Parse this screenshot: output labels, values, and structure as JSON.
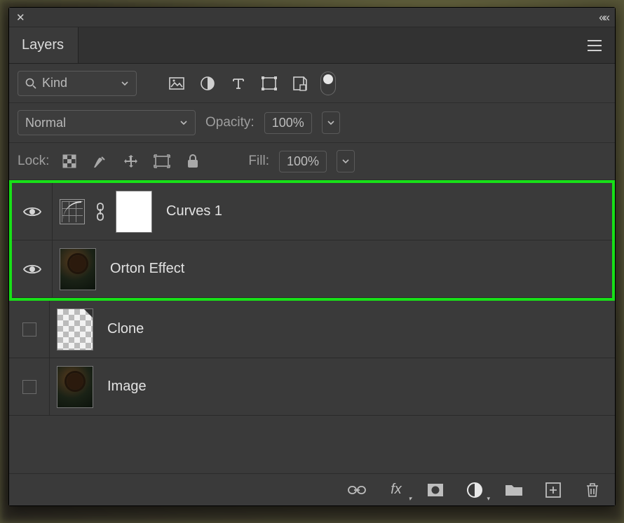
{
  "panel": {
    "tab_label": "Layers",
    "close_glyph": "✕",
    "collapse_glyph": "««",
    "menu_glyph": "≡"
  },
  "filter": {
    "selected": "Kind",
    "icons": [
      "image",
      "adjustment",
      "type",
      "shape",
      "smartobject",
      "toggle"
    ]
  },
  "blend": {
    "mode": "Normal",
    "opacity_label": "Opacity:",
    "opacity_value": "100%"
  },
  "lock": {
    "label": "Lock:",
    "fill_label": "Fill:",
    "fill_value": "100%"
  },
  "layers": [
    {
      "name": "Curves 1",
      "visible": true,
      "kind": "curves",
      "mask": true,
      "highlighted": true
    },
    {
      "name": "Orton Effect",
      "visible": true,
      "kind": "photo",
      "highlighted": true
    },
    {
      "name": "Clone",
      "visible": false,
      "kind": "checker",
      "highlighted": false
    },
    {
      "name": "Image",
      "visible": false,
      "kind": "photo",
      "highlighted": false
    }
  ],
  "footer_icons": [
    "link",
    "fx",
    "mask",
    "adjustment",
    "group",
    "new",
    "trash"
  ]
}
